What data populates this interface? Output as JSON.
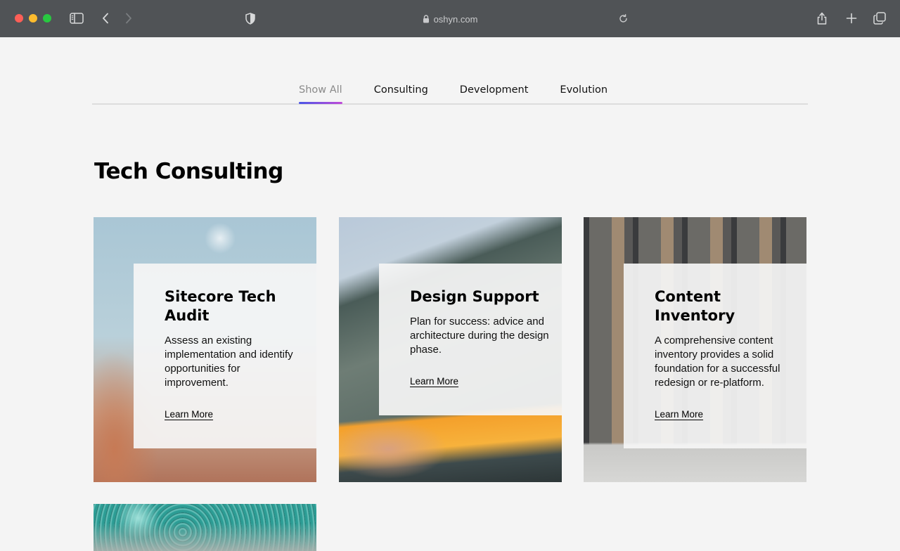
{
  "browser": {
    "url": "oshyn.com"
  },
  "filters": {
    "tabs": [
      {
        "label": "Show All",
        "active": true
      },
      {
        "label": "Consulting",
        "active": false
      },
      {
        "label": "Development",
        "active": false
      },
      {
        "label": "Evolution",
        "active": false
      }
    ]
  },
  "section": {
    "title": "Tech Consulting"
  },
  "cards": [
    {
      "title": "Sitecore Tech Audit",
      "description": "Assess an existing implementation and identify opportunities for improvement.",
      "link": "Learn More"
    },
    {
      "title": "Design Support",
      "description": "Plan for success: advice and architecture during the design phase.",
      "link": "Learn More"
    },
    {
      "title": "Content Inventory",
      "description": "A comprehensive content inventory provides a solid foundation for a successful redesign or re-platform.",
      "link": "Learn More"
    }
  ],
  "colors": {
    "chrome_bg": "#505356",
    "page_bg": "#f4f4f4",
    "tab_underline_start": "#4a55e6",
    "tab_underline_end": "#c04bd8"
  },
  "icons": {
    "sidebar": "sidebar-icon",
    "back": "chevron-left-icon",
    "forward": "chevron-right-icon",
    "privacy": "shield-icon",
    "secure": "lock-icon",
    "reload": "reload-icon",
    "share": "share-icon",
    "new_tab": "plus-icon",
    "tab_overview": "tabs-icon"
  }
}
